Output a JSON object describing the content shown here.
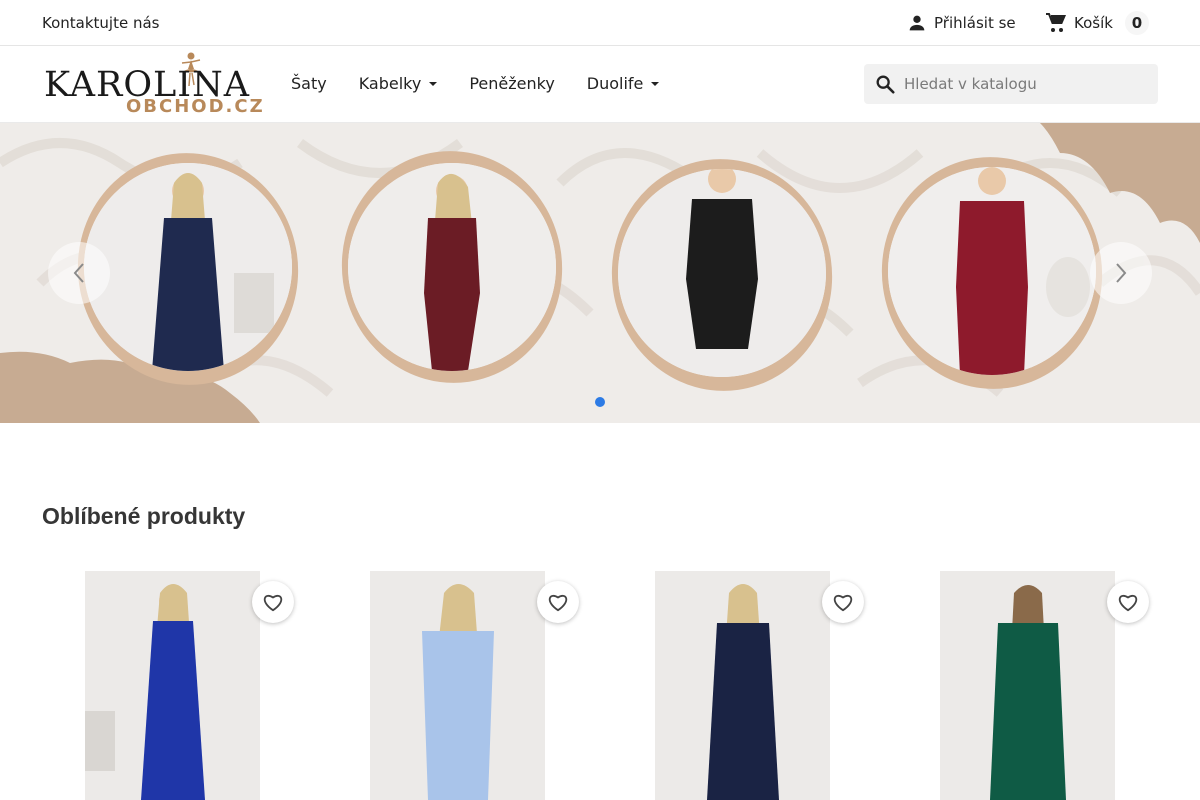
{
  "topbar": {
    "contact": "Kontaktujte nás",
    "login": "Přihlásit se",
    "cart_label": "Košík",
    "cart_count": "0"
  },
  "header": {
    "logo_main": "KAROLINA",
    "logo_sub": "OBCHOD.CZ",
    "nav": [
      {
        "label": "Šaty",
        "dropdown": false
      },
      {
        "label": "Kabelky",
        "dropdown": true
      },
      {
        "label": "Peněženky",
        "dropdown": false
      },
      {
        "label": "Duolife",
        "dropdown": true
      }
    ],
    "search_placeholder": "Hledat v katalogu"
  },
  "hero": {
    "slides": [
      {
        "dress_color": "#1f2a4f"
      },
      {
        "dress_color": "#6b1c25"
      },
      {
        "dress_color": "#1c1c1c"
      },
      {
        "dress_color": "#8e1a2c"
      }
    ],
    "active_dot": 0,
    "accent": "#2d7be5"
  },
  "products": {
    "title": "Oblíbené produkty",
    "items": [
      {
        "dress_color": "#1f36a8"
      },
      {
        "dress_color": "#a9c4ea"
      },
      {
        "dress_color": "#1a2344"
      },
      {
        "dress_color": "#0f5b45"
      }
    ]
  },
  "icons": {
    "user": "user-icon",
    "cart": "cart-icon",
    "search": "search-icon",
    "prev": "chevron-left-icon",
    "next": "chevron-right-icon",
    "favorite": "heart-outline-icon"
  }
}
